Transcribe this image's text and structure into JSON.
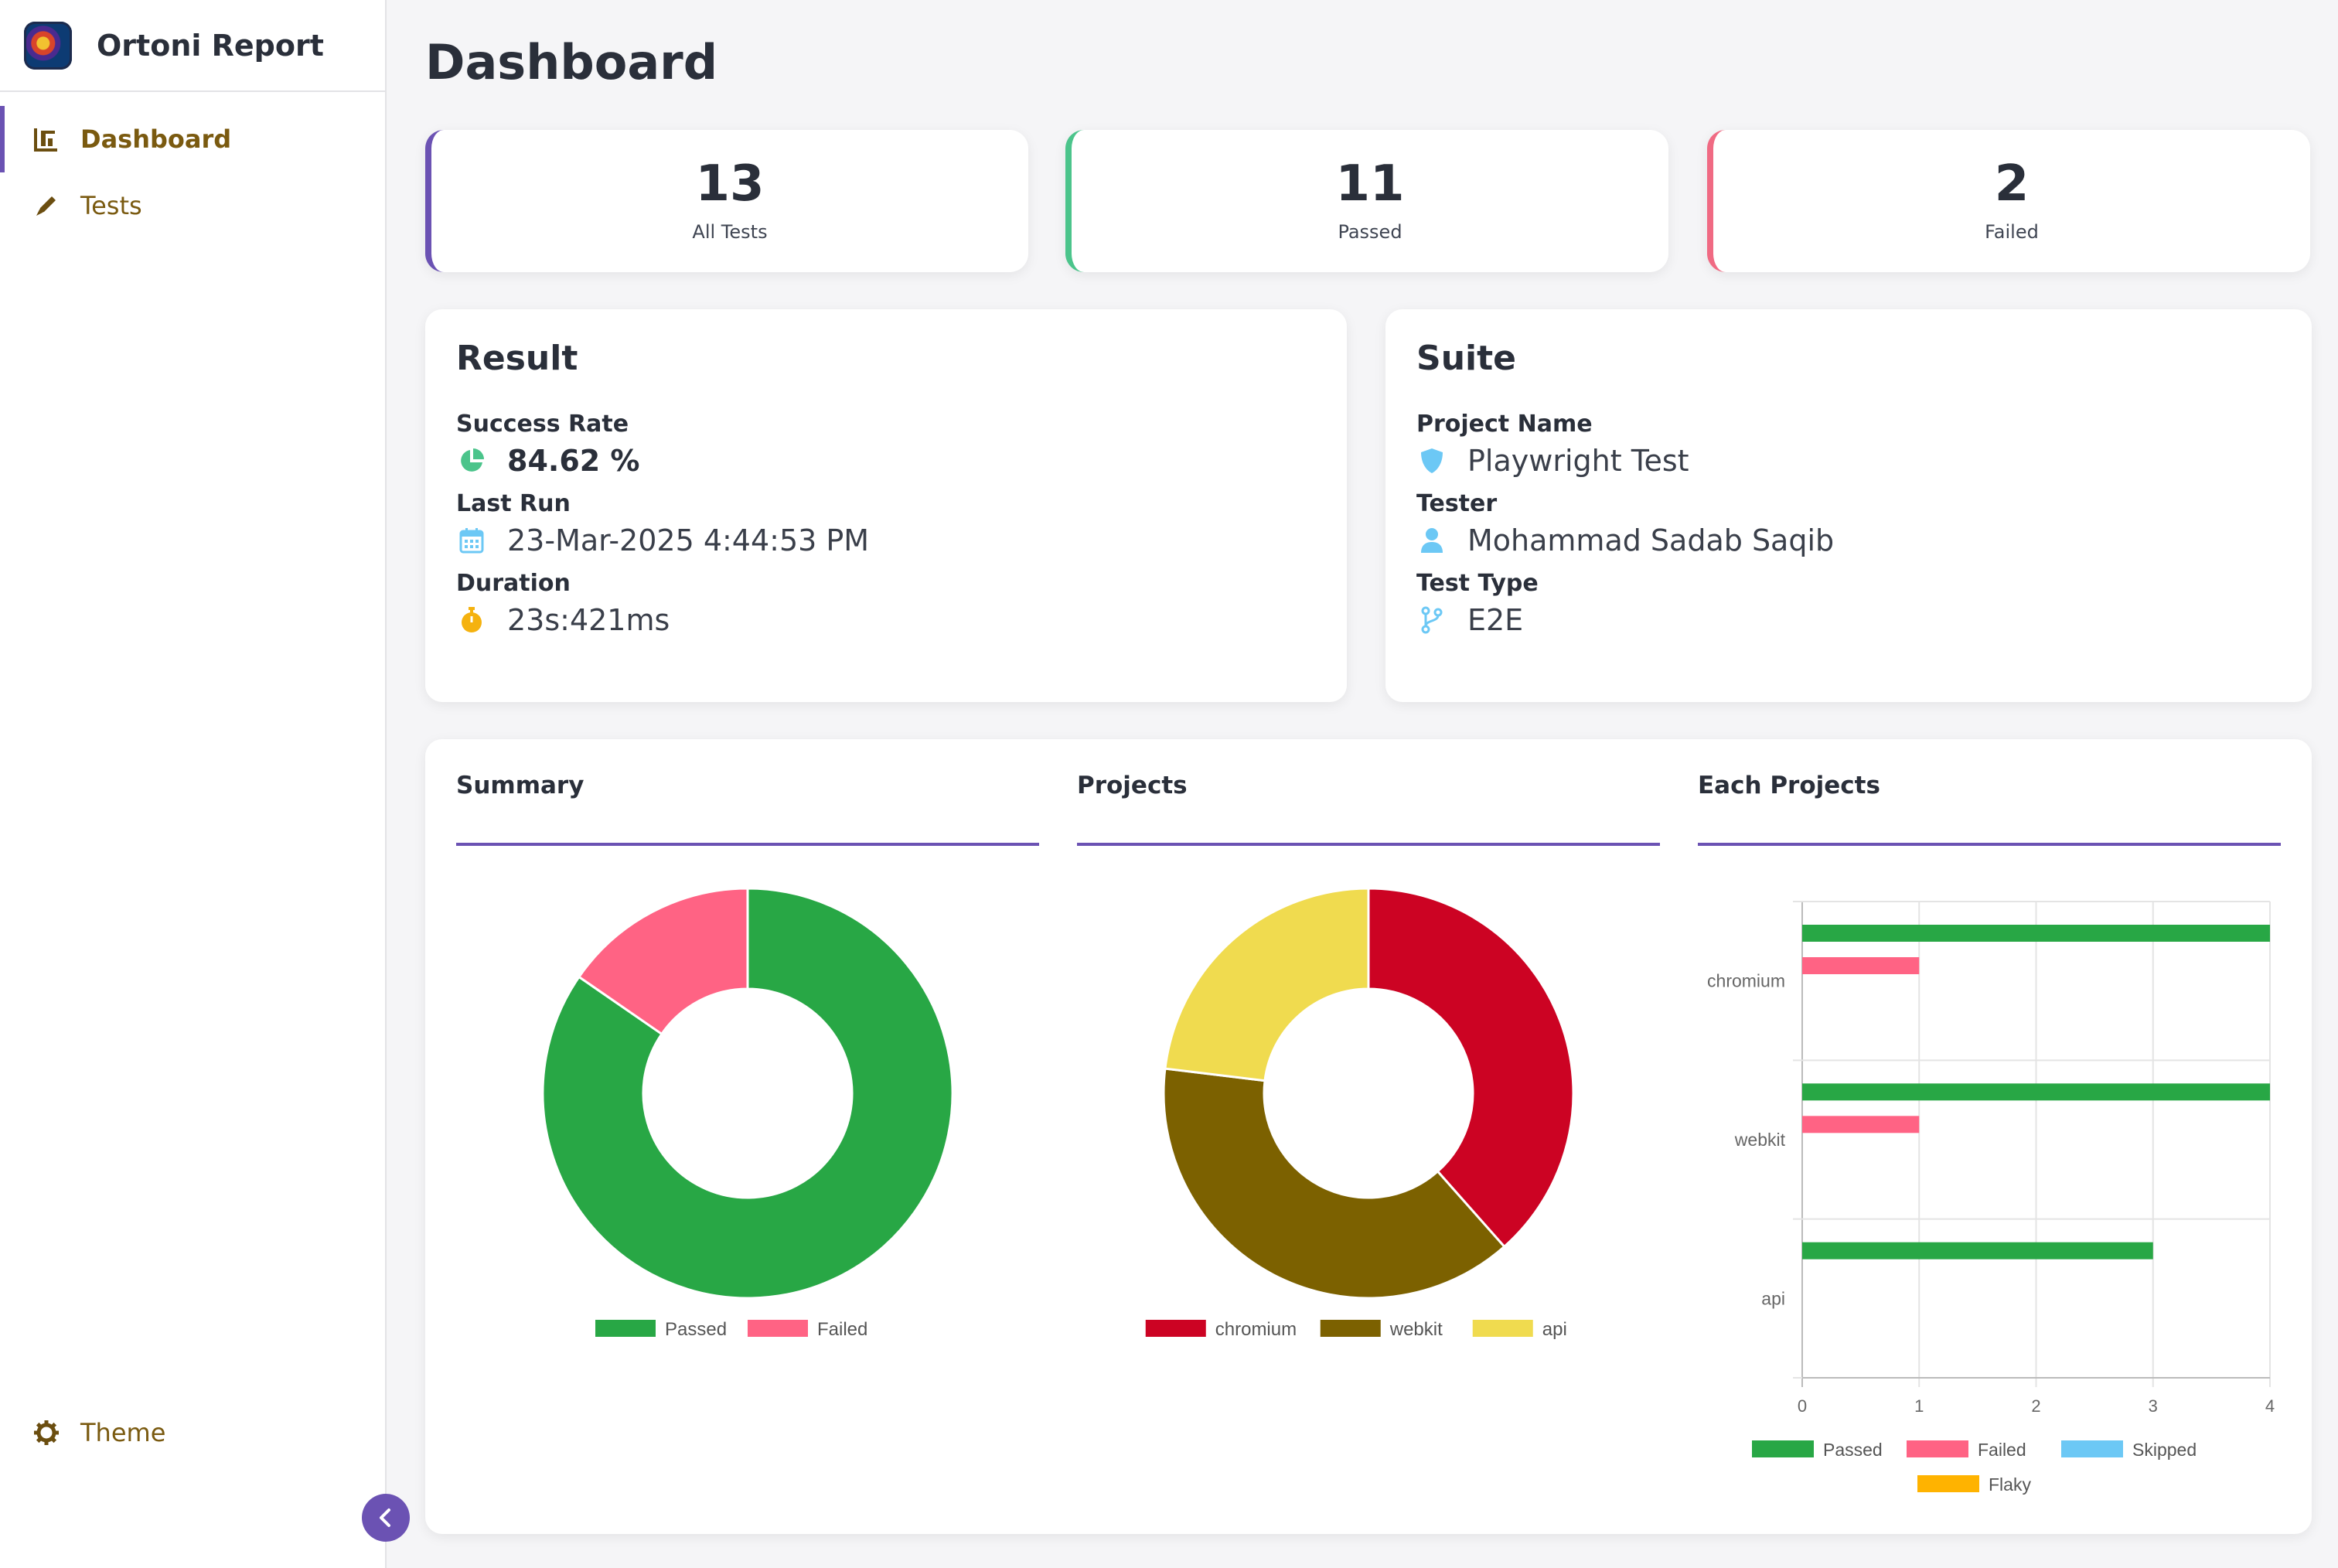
{
  "sidebar": {
    "brand": "Ortoni Report",
    "items": [
      {
        "label": "Dashboard",
        "icon": "bar-chart-icon",
        "active": true
      },
      {
        "label": "Tests",
        "icon": "pencil-icon",
        "active": false
      }
    ],
    "theme_label": "Theme",
    "collapse_icon": "chevron-left-icon"
  },
  "page": {
    "title": "Dashboard"
  },
  "stats": [
    {
      "value": "13",
      "label": "All Tests"
    },
    {
      "value": "11",
      "label": "Passed"
    },
    {
      "value": "2",
      "label": "Failed"
    }
  ],
  "result": {
    "title": "Result",
    "success_rate_label": "Success Rate",
    "success_rate": "84.62 %",
    "last_run_label": "Last Run",
    "last_run": "23-Mar-2025 4:44:53 PM",
    "duration_label": "Duration",
    "duration": "23s:421ms"
  },
  "suite": {
    "title": "Suite",
    "project_name_label": "Project Name",
    "project_name": "Playwright Test",
    "tester_label": "Tester",
    "tester": "Mohammad Sadab Saqib",
    "test_type_label": "Test Type",
    "test_type": "E2E"
  },
  "colors": {
    "accent": "#6b52b3",
    "passed": "#28a745",
    "failed": "#ff6384",
    "skipped": "#6cc8f5",
    "flaky": "#ffb300",
    "chromium": "#cc0323",
    "webkit": "#7c6100",
    "api": "#f0db4f"
  },
  "chart_data": [
    {
      "type": "pie",
      "title": "Summary",
      "donut": true,
      "categories": [
        "Passed",
        "Failed"
      ],
      "values": [
        11,
        2
      ],
      "colors": [
        "#28a745",
        "#ff6384"
      ],
      "legend": "bottom"
    },
    {
      "type": "pie",
      "title": "Projects",
      "donut": true,
      "categories": [
        "chromium",
        "webkit",
        "api"
      ],
      "values": [
        5,
        5,
        3
      ],
      "colors": [
        "#cc0323",
        "#7c6100",
        "#f0db4f"
      ],
      "legend": "bottom"
    },
    {
      "type": "bar",
      "orientation": "horizontal",
      "title": "Each Projects",
      "categories": [
        "chromium",
        "webkit",
        "api"
      ],
      "series": [
        {
          "name": "Passed",
          "values": [
            4,
            4,
            3
          ],
          "color": "#28a745"
        },
        {
          "name": "Failed",
          "values": [
            1,
            1,
            0
          ],
          "color": "#ff6384"
        },
        {
          "name": "Skipped",
          "values": [
            0,
            0,
            0
          ],
          "color": "#6cc8f5"
        },
        {
          "name": "Flaky",
          "values": [
            0,
            0,
            0
          ],
          "color": "#ffb300"
        }
      ],
      "xlim": [
        0,
        4
      ],
      "xticks": [
        "0",
        "1",
        "2",
        "3",
        "4"
      ],
      "grid": true,
      "legend": "bottom"
    }
  ]
}
